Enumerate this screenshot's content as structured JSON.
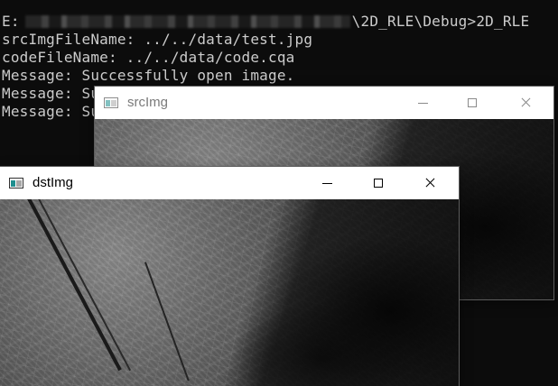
{
  "console": {
    "lines": [
      {
        "prefix": "E:",
        "suffix": "\\2D_RLE\\Debug>2D_RLE"
      },
      {
        "text": "srcImgFileName: ../../data/test.jpg"
      },
      {
        "text": "codeFileName: ../../data/code.cqa"
      },
      {
        "text": "Message: Successfully open image."
      },
      {
        "text": "Message: Su"
      },
      {
        "text": "Message: Su"
      }
    ]
  },
  "windows": {
    "src": {
      "title": "srcImg",
      "active": false
    },
    "dst": {
      "title": "dstImg",
      "active": true
    }
  },
  "colors": {
    "console_bg": "#0c0c0c",
    "console_text": "#cccccc",
    "titlebar_bg": "#ffffff"
  }
}
